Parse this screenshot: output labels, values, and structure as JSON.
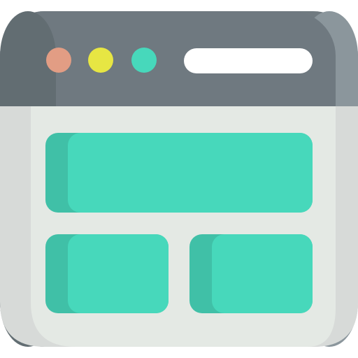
{
  "icon": {
    "name": "browser-window-layout-icon",
    "colors": {
      "frame_dark": "#626d72",
      "frame_mid": "#707a80",
      "frame_light": "#8b969c",
      "body_shade": "#d7dad8",
      "body_light": "#e4e9e4",
      "accent": "#47d8bb",
      "accent_shade": "#40c0a7",
      "dot_red": "#e29d84",
      "dot_yellow": "#e7e643",
      "dot_teal": "#47d8bb",
      "address_bar": "#ffffff"
    }
  }
}
